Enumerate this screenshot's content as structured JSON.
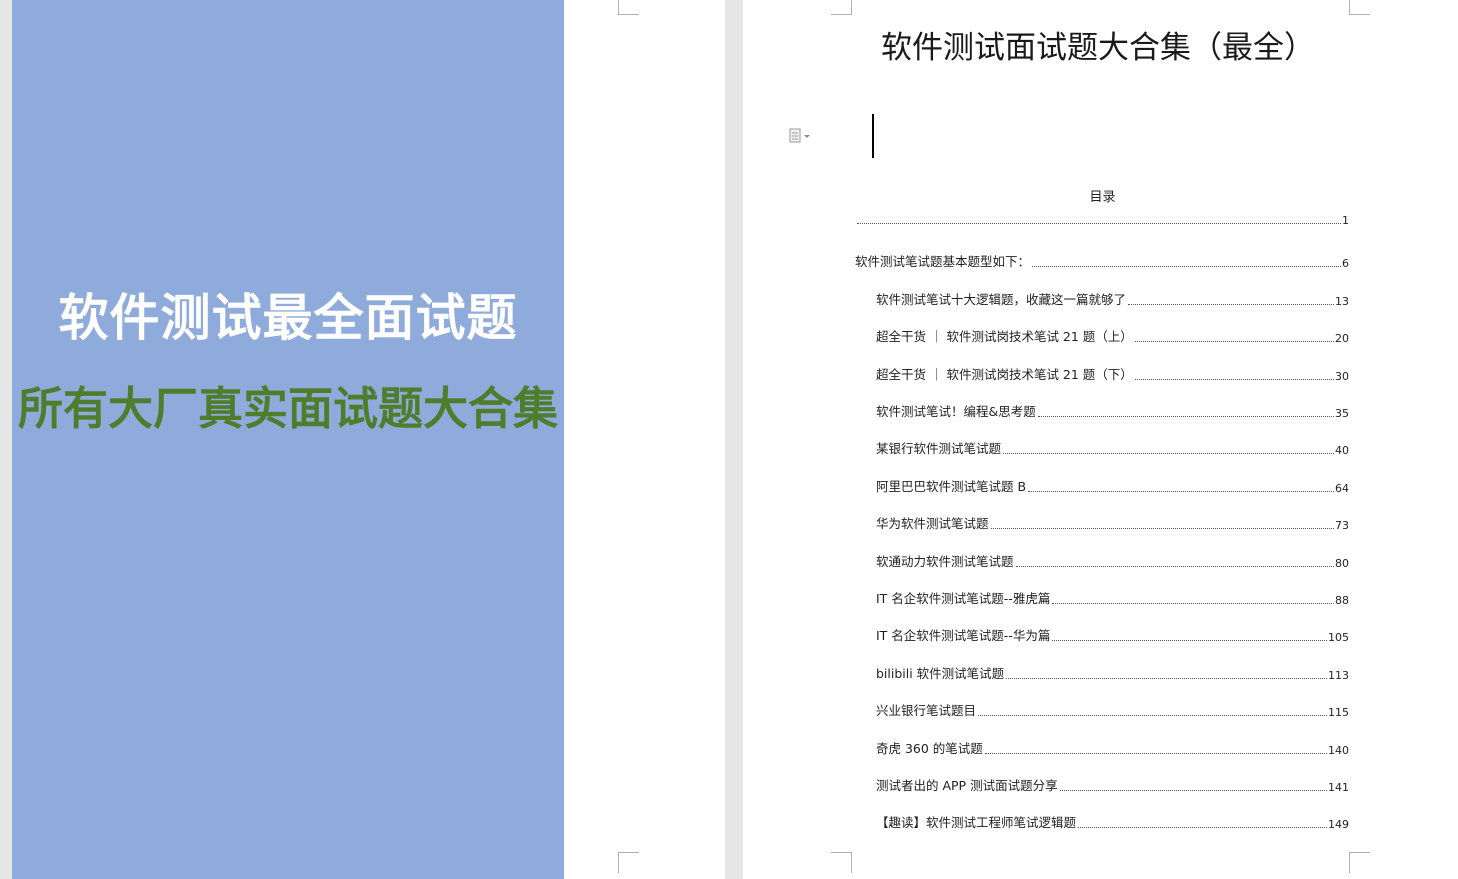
{
  "cover": {
    "title": "软件测试最全面试题",
    "subtitle": "所有大厂真实面试题大合集",
    "panel_color": "#8eabdc",
    "subtitle_color": "#4f7d2c"
  },
  "document": {
    "title": "软件测试面试题大合集（最全）",
    "paste_icon": "paste-options-icon",
    "toc_heading": "目录",
    "toc": [
      {
        "label": "",
        "page": "1",
        "level": 1
      },
      {
        "label": "软件测试笔试题基本题型如下：",
        "page": "6",
        "level": 1
      },
      {
        "label": "软件测试笔试十大逻辑题，收藏这一篇就够了",
        "page": "13",
        "level": 2
      },
      {
        "label": "超全干货 ｜ 软件测试岗技术笔试 21 题（上）",
        "page": "20",
        "level": 2
      },
      {
        "label": "超全干货 ｜ 软件测试岗技术笔试 21 题（下）",
        "page": "30",
        "level": 2
      },
      {
        "label": "软件测试笔试！编程&思考题",
        "page": "35",
        "level": 2
      },
      {
        "label": "某银行软件测试笔试题",
        "page": "40",
        "level": 2
      },
      {
        "label": "阿里巴巴软件测试笔试题  B",
        "page": "64",
        "level": 2
      },
      {
        "label": "华为软件测试笔试题",
        "page": "73",
        "level": 2
      },
      {
        "label": "软通动力软件测试笔试题",
        "page": "80",
        "level": 2
      },
      {
        "label": "IT 名企软件测试笔试题--雅虎篇",
        "page": "88",
        "level": 2
      },
      {
        "label": "IT 名企软件测试笔试题--华为篇",
        "page": "105",
        "level": 2
      },
      {
        "label": "bilibili 软件测试笔试题",
        "page": "113",
        "level": 2
      },
      {
        "label": "兴业银行笔试题目",
        "page": "115",
        "level": 2
      },
      {
        "label": "奇虎 360 的笔试题",
        "page": "140",
        "level": 2
      },
      {
        "label": "测试者出的 APP 测试面试题分享",
        "page": "141",
        "level": 2
      },
      {
        "label": "【趣读】软件测试工程师笔试逻辑题",
        "page": "149",
        "level": 2
      }
    ]
  }
}
